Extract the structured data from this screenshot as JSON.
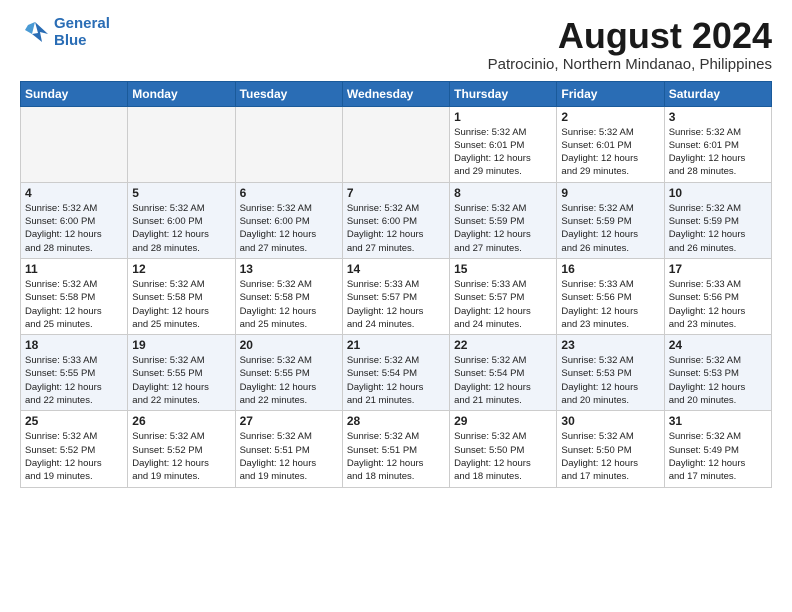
{
  "logo": {
    "line1": "General",
    "line2": "Blue"
  },
  "title": "August 2024",
  "subtitle": "Patrocinio, Northern Mindanao, Philippines",
  "weekdays": [
    "Sunday",
    "Monday",
    "Tuesday",
    "Wednesday",
    "Thursday",
    "Friday",
    "Saturday"
  ],
  "weeks": [
    [
      {
        "day": "",
        "info": ""
      },
      {
        "day": "",
        "info": ""
      },
      {
        "day": "",
        "info": ""
      },
      {
        "day": "",
        "info": ""
      },
      {
        "day": "1",
        "info": "Sunrise: 5:32 AM\nSunset: 6:01 PM\nDaylight: 12 hours\nand 29 minutes."
      },
      {
        "day": "2",
        "info": "Sunrise: 5:32 AM\nSunset: 6:01 PM\nDaylight: 12 hours\nand 29 minutes."
      },
      {
        "day": "3",
        "info": "Sunrise: 5:32 AM\nSunset: 6:01 PM\nDaylight: 12 hours\nand 28 minutes."
      }
    ],
    [
      {
        "day": "4",
        "info": "Sunrise: 5:32 AM\nSunset: 6:00 PM\nDaylight: 12 hours\nand 28 minutes."
      },
      {
        "day": "5",
        "info": "Sunrise: 5:32 AM\nSunset: 6:00 PM\nDaylight: 12 hours\nand 28 minutes."
      },
      {
        "day": "6",
        "info": "Sunrise: 5:32 AM\nSunset: 6:00 PM\nDaylight: 12 hours\nand 27 minutes."
      },
      {
        "day": "7",
        "info": "Sunrise: 5:32 AM\nSunset: 6:00 PM\nDaylight: 12 hours\nand 27 minutes."
      },
      {
        "day": "8",
        "info": "Sunrise: 5:32 AM\nSunset: 5:59 PM\nDaylight: 12 hours\nand 27 minutes."
      },
      {
        "day": "9",
        "info": "Sunrise: 5:32 AM\nSunset: 5:59 PM\nDaylight: 12 hours\nand 26 minutes."
      },
      {
        "day": "10",
        "info": "Sunrise: 5:32 AM\nSunset: 5:59 PM\nDaylight: 12 hours\nand 26 minutes."
      }
    ],
    [
      {
        "day": "11",
        "info": "Sunrise: 5:32 AM\nSunset: 5:58 PM\nDaylight: 12 hours\nand 25 minutes."
      },
      {
        "day": "12",
        "info": "Sunrise: 5:32 AM\nSunset: 5:58 PM\nDaylight: 12 hours\nand 25 minutes."
      },
      {
        "day": "13",
        "info": "Sunrise: 5:32 AM\nSunset: 5:58 PM\nDaylight: 12 hours\nand 25 minutes."
      },
      {
        "day": "14",
        "info": "Sunrise: 5:33 AM\nSunset: 5:57 PM\nDaylight: 12 hours\nand 24 minutes."
      },
      {
        "day": "15",
        "info": "Sunrise: 5:33 AM\nSunset: 5:57 PM\nDaylight: 12 hours\nand 24 minutes."
      },
      {
        "day": "16",
        "info": "Sunrise: 5:33 AM\nSunset: 5:56 PM\nDaylight: 12 hours\nand 23 minutes."
      },
      {
        "day": "17",
        "info": "Sunrise: 5:33 AM\nSunset: 5:56 PM\nDaylight: 12 hours\nand 23 minutes."
      }
    ],
    [
      {
        "day": "18",
        "info": "Sunrise: 5:33 AM\nSunset: 5:55 PM\nDaylight: 12 hours\nand 22 minutes."
      },
      {
        "day": "19",
        "info": "Sunrise: 5:32 AM\nSunset: 5:55 PM\nDaylight: 12 hours\nand 22 minutes."
      },
      {
        "day": "20",
        "info": "Sunrise: 5:32 AM\nSunset: 5:55 PM\nDaylight: 12 hours\nand 22 minutes."
      },
      {
        "day": "21",
        "info": "Sunrise: 5:32 AM\nSunset: 5:54 PM\nDaylight: 12 hours\nand 21 minutes."
      },
      {
        "day": "22",
        "info": "Sunrise: 5:32 AM\nSunset: 5:54 PM\nDaylight: 12 hours\nand 21 minutes."
      },
      {
        "day": "23",
        "info": "Sunrise: 5:32 AM\nSunset: 5:53 PM\nDaylight: 12 hours\nand 20 minutes."
      },
      {
        "day": "24",
        "info": "Sunrise: 5:32 AM\nSunset: 5:53 PM\nDaylight: 12 hours\nand 20 minutes."
      }
    ],
    [
      {
        "day": "25",
        "info": "Sunrise: 5:32 AM\nSunset: 5:52 PM\nDaylight: 12 hours\nand 19 minutes."
      },
      {
        "day": "26",
        "info": "Sunrise: 5:32 AM\nSunset: 5:52 PM\nDaylight: 12 hours\nand 19 minutes."
      },
      {
        "day": "27",
        "info": "Sunrise: 5:32 AM\nSunset: 5:51 PM\nDaylight: 12 hours\nand 19 minutes."
      },
      {
        "day": "28",
        "info": "Sunrise: 5:32 AM\nSunset: 5:51 PM\nDaylight: 12 hours\nand 18 minutes."
      },
      {
        "day": "29",
        "info": "Sunrise: 5:32 AM\nSunset: 5:50 PM\nDaylight: 12 hours\nand 18 minutes."
      },
      {
        "day": "30",
        "info": "Sunrise: 5:32 AM\nSunset: 5:50 PM\nDaylight: 12 hours\nand 17 minutes."
      },
      {
        "day": "31",
        "info": "Sunrise: 5:32 AM\nSunset: 5:49 PM\nDaylight: 12 hours\nand 17 minutes."
      }
    ]
  ]
}
